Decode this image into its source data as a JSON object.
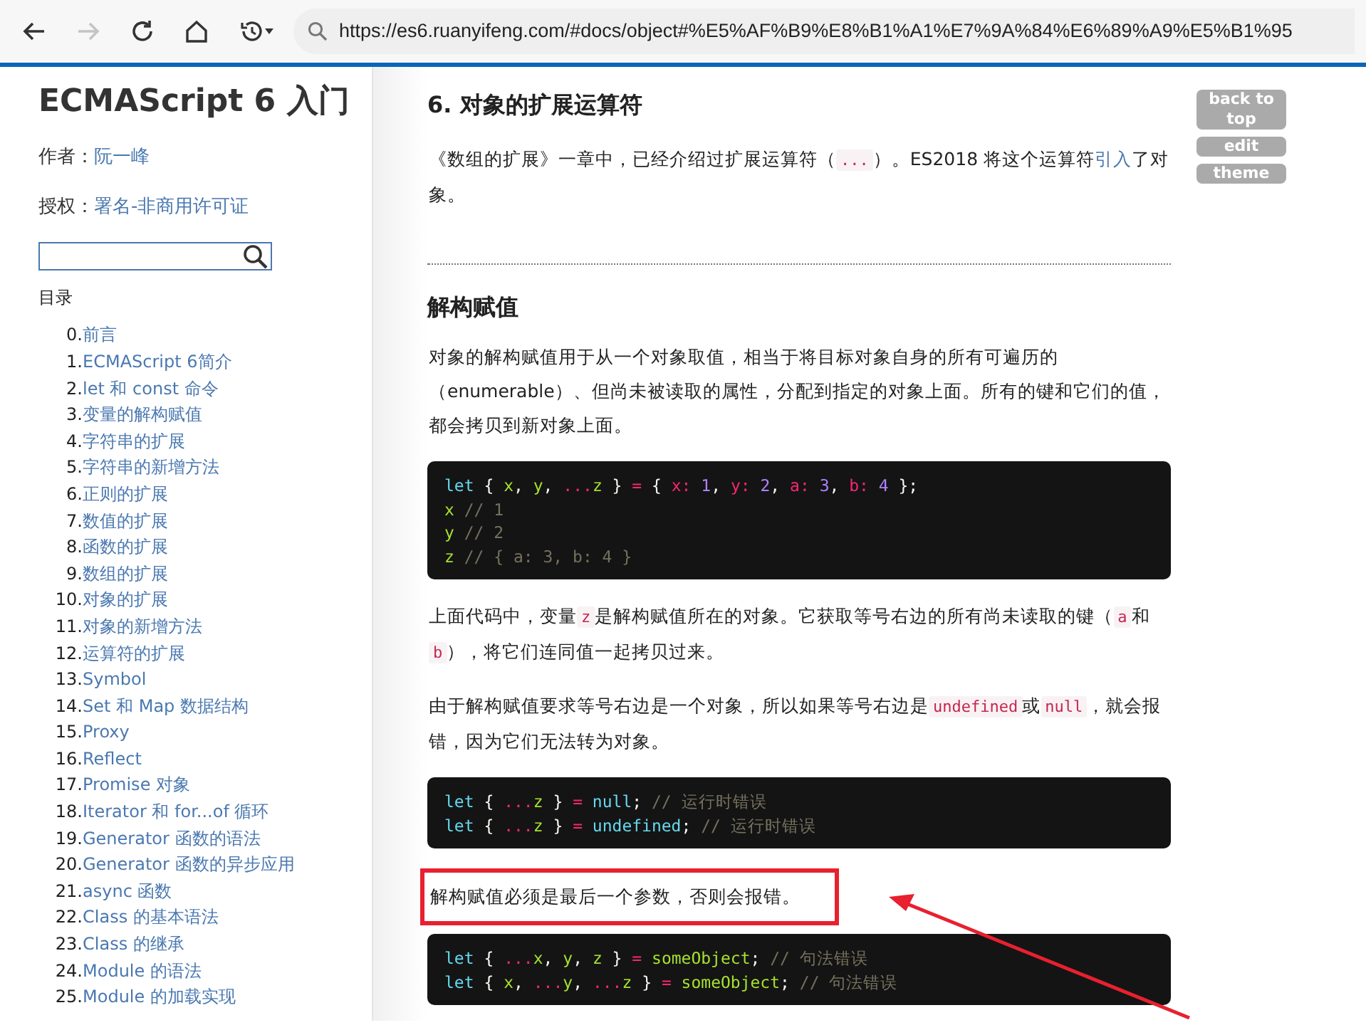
{
  "browser": {
    "back_disabled": false,
    "forward_disabled": true,
    "url": "https://es6.ruanyifeng.com/#docs/object#%E5%AF%B9%E8%B1%A1%E7%9A%84%E6%89%A9%E5%B1%95"
  },
  "sidebar": {
    "title": "ECMAScript 6 入门",
    "meta": [
      {
        "label": "作者：",
        "link": "阮一峰"
      },
      {
        "label": "授权：",
        "link": "署名-非商用许可证"
      }
    ],
    "toc_heading": "目录",
    "toc": [
      {
        "num": "0.",
        "title": "前言"
      },
      {
        "num": "1.",
        "title": "ECMAScript 6简介"
      },
      {
        "num": "2.",
        "title": "let 和 const 命令"
      },
      {
        "num": "3.",
        "title": "变量的解构赋值"
      },
      {
        "num": "4.",
        "title": "字符串的扩展"
      },
      {
        "num": "5.",
        "title": "字符串的新增方法"
      },
      {
        "num": "6.",
        "title": "正则的扩展"
      },
      {
        "num": "7.",
        "title": "数值的扩展"
      },
      {
        "num": "8.",
        "title": "函数的扩展"
      },
      {
        "num": "9.",
        "title": "数组的扩展"
      },
      {
        "num": "10.",
        "title": "对象的扩展"
      },
      {
        "num": "11.",
        "title": "对象的新增方法"
      },
      {
        "num": "12.",
        "title": "运算符的扩展"
      },
      {
        "num": "13.",
        "title": "Symbol"
      },
      {
        "num": "14.",
        "title": "Set 和 Map 数据结构"
      },
      {
        "num": "15.",
        "title": "Proxy"
      },
      {
        "num": "16.",
        "title": "Reflect"
      },
      {
        "num": "17.",
        "title": "Promise 对象"
      },
      {
        "num": "18.",
        "title": "Iterator 和 for...of 循环"
      },
      {
        "num": "19.",
        "title": "Generator 函数的语法"
      },
      {
        "num": "20.",
        "title": "Generator 函数的异步应用"
      },
      {
        "num": "21.",
        "title": "async 函数"
      },
      {
        "num": "22.",
        "title": "Class 的基本语法"
      },
      {
        "num": "23.",
        "title": "Class 的继承"
      },
      {
        "num": "24.",
        "title": "Module 的语法"
      },
      {
        "num": "25.",
        "title": "Module 的加载实现"
      }
    ]
  },
  "side_buttons": [
    "back to top",
    "edit",
    "theme"
  ],
  "content": [
    {
      "kind": "h2",
      "text": "6. 对象的扩展运算符"
    },
    {
      "kind": "p",
      "highlighted": false,
      "segments": [
        {
          "kind": "text",
          "t": "《数组的扩展》一章中，已经介绍过扩展运算符（"
        },
        {
          "kind": "code",
          "t": "..."
        },
        {
          "kind": "text",
          "t": "）。ES2018 将这个运算符"
        },
        {
          "kind": "link",
          "t": "引入"
        },
        {
          "kind": "text",
          "t": "了对象。"
        }
      ]
    },
    {
      "kind": "hr"
    },
    {
      "kind": "h3",
      "text": "解构赋值"
    },
    {
      "kind": "p",
      "highlighted": false,
      "segments": [
        {
          "kind": "text",
          "t": "对象的解构赋值用于从一个对象取值，相当于将目标对象自身的所有可遍历的（enumerable）、但尚未被读取的属性，分配到指定的对象上面。所有的键和它们的值，都会拷贝到新对象上面。"
        }
      ]
    },
    {
      "kind": "code",
      "lines": [
        [
          {
            "kind": "kw",
            "t": "let"
          },
          {
            "kind": "p",
            "t": " { "
          },
          {
            "kind": "v",
            "t": "x"
          },
          {
            "kind": "p",
            "t": ", "
          },
          {
            "kind": "v",
            "t": "y"
          },
          {
            "kind": "p",
            "t": ", "
          },
          {
            "kind": "op",
            "t": "..."
          },
          {
            "kind": "v",
            "t": "z"
          },
          {
            "kind": "p",
            "t": " } "
          },
          {
            "kind": "op",
            "t": "="
          },
          {
            "kind": "p",
            "t": " { "
          },
          {
            "kind": "key",
            "t": "x:"
          },
          {
            "kind": "num",
            "t": " 1"
          },
          {
            "kind": "p",
            "t": ", "
          },
          {
            "kind": "key",
            "t": "y:"
          },
          {
            "kind": "num",
            "t": " 2"
          },
          {
            "kind": "p",
            "t": ", "
          },
          {
            "kind": "key",
            "t": "a:"
          },
          {
            "kind": "num",
            "t": " 3"
          },
          {
            "kind": "p",
            "t": ", "
          },
          {
            "kind": "key",
            "t": "b:"
          },
          {
            "kind": "num",
            "t": " 4"
          },
          {
            "kind": "p",
            "t": " };"
          }
        ],
        [
          {
            "kind": "v",
            "t": "x"
          },
          {
            "kind": "com",
            "t": " // 1"
          }
        ],
        [
          {
            "kind": "v",
            "t": "y"
          },
          {
            "kind": "com",
            "t": " // 2"
          }
        ],
        [
          {
            "kind": "v",
            "t": "z"
          },
          {
            "kind": "com",
            "t": " // { a: 3, b: 4 }"
          }
        ]
      ]
    },
    {
      "kind": "p",
      "highlighted": false,
      "segments": [
        {
          "kind": "text",
          "t": "上面代码中，变量"
        },
        {
          "kind": "code",
          "t": "z"
        },
        {
          "kind": "text",
          "t": "是解构赋值所在的对象。它获取等号右边的所有尚未读取的键（"
        },
        {
          "kind": "code",
          "t": "a"
        },
        {
          "kind": "text",
          "t": "和"
        },
        {
          "kind": "code",
          "t": "b"
        },
        {
          "kind": "text",
          "t": "），将它们连同值一起拷贝过来。"
        }
      ]
    },
    {
      "kind": "p",
      "highlighted": false,
      "segments": [
        {
          "kind": "text",
          "t": "由于解构赋值要求等号右边是一个对象，所以如果等号右边是"
        },
        {
          "kind": "code",
          "t": "undefined"
        },
        {
          "kind": "text",
          "t": "或"
        },
        {
          "kind": "code",
          "t": "null"
        },
        {
          "kind": "text",
          "t": "，就会报错，因为它们无法转为对象。"
        }
      ]
    },
    {
      "kind": "code",
      "lines": [
        [
          {
            "kind": "kw",
            "t": "let"
          },
          {
            "kind": "p",
            "t": " { "
          },
          {
            "kind": "op",
            "t": "..."
          },
          {
            "kind": "v",
            "t": "z"
          },
          {
            "kind": "p",
            "t": " } "
          },
          {
            "kind": "op",
            "t": "="
          },
          {
            "kind": "lit",
            "t": " null"
          },
          {
            "kind": "p",
            "t": "; "
          },
          {
            "kind": "com",
            "t": "// 运行时错误"
          }
        ],
        [
          {
            "kind": "kw",
            "t": "let"
          },
          {
            "kind": "p",
            "t": " { "
          },
          {
            "kind": "op",
            "t": "..."
          },
          {
            "kind": "v",
            "t": "z"
          },
          {
            "kind": "p",
            "t": " } "
          },
          {
            "kind": "op",
            "t": "="
          },
          {
            "kind": "lit",
            "t": " undefined"
          },
          {
            "kind": "p",
            "t": "; "
          },
          {
            "kind": "com",
            "t": "// 运行时错误"
          }
        ]
      ]
    },
    {
      "kind": "p",
      "highlighted": true,
      "segments": [
        {
          "kind": "text",
          "t": "解构赋值必须是最后一个参数，否则会报错。"
        }
      ]
    },
    {
      "kind": "code",
      "lines": [
        [
          {
            "kind": "kw",
            "t": "let"
          },
          {
            "kind": "p",
            "t": " { "
          },
          {
            "kind": "op",
            "t": "..."
          },
          {
            "kind": "v",
            "t": "x"
          },
          {
            "kind": "p",
            "t": ", "
          },
          {
            "kind": "v",
            "t": "y"
          },
          {
            "kind": "p",
            "t": ", "
          },
          {
            "kind": "v",
            "t": "z"
          },
          {
            "kind": "p",
            "t": " } "
          },
          {
            "kind": "op",
            "t": "="
          },
          {
            "kind": "v",
            "t": " someObject"
          },
          {
            "kind": "p",
            "t": "; "
          },
          {
            "kind": "com",
            "t": "// 句法错误"
          }
        ],
        [
          {
            "kind": "kw",
            "t": "let"
          },
          {
            "kind": "p",
            "t": " { "
          },
          {
            "kind": "v",
            "t": "x"
          },
          {
            "kind": "p",
            "t": ", "
          },
          {
            "kind": "op",
            "t": "..."
          },
          {
            "kind": "v",
            "t": "y"
          },
          {
            "kind": "p",
            "t": ", "
          },
          {
            "kind": "op",
            "t": "..."
          },
          {
            "kind": "v",
            "t": "z"
          },
          {
            "kind": "p",
            "t": " } "
          },
          {
            "kind": "op",
            "t": "="
          },
          {
            "kind": "v",
            "t": " someObject"
          },
          {
            "kind": "p",
            "t": "; "
          },
          {
            "kind": "com",
            "t": "// 句法错误"
          }
        ]
      ]
    }
  ]
}
